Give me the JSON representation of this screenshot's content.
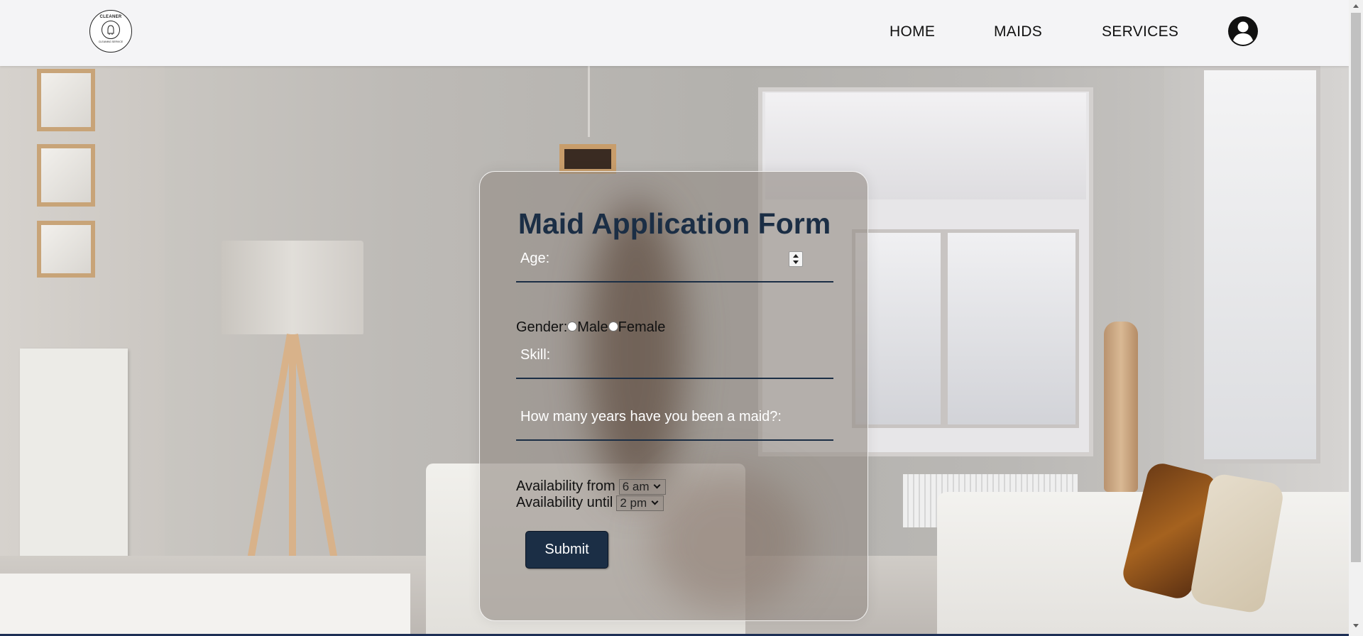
{
  "header": {
    "logo_text": "CLEANER",
    "logo_subtext": "CLEANING SERVICE",
    "nav": [
      {
        "label": "HOME"
      },
      {
        "label": "MAIDS"
      },
      {
        "label": "SERVICES"
      }
    ],
    "profile_icon": "user-circle-icon"
  },
  "form": {
    "title": "Maid Application Form",
    "age_label": "Age:",
    "gender_label": "Gender:",
    "gender_options": [
      "Male",
      "Female"
    ],
    "skill_label": "Skill:",
    "years_label": "How many years have you been a maid?:",
    "availability_from_label": "Availability from",
    "availability_from_value": "6 am",
    "availability_until_label": "Availability until",
    "availability_until_value": "2 pm",
    "submit_label": "Submit"
  },
  "colors": {
    "title": "#1b2e45",
    "submit_bg": "#1b2e45",
    "header_bg": "#f4f4f6"
  }
}
